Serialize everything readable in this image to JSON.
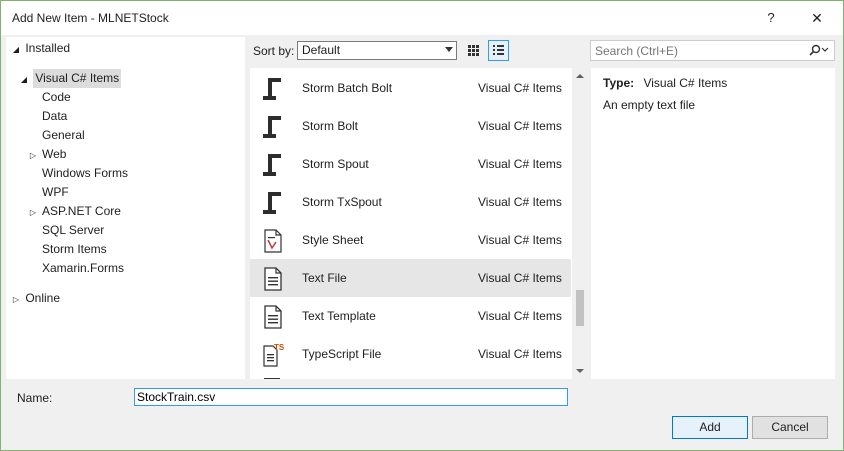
{
  "window": {
    "title": "Add New Item - MLNETStock",
    "help_label": "?",
    "close_label": "✕"
  },
  "tree": {
    "installed": "Installed",
    "root": "Visual C# Items",
    "children": [
      "Code",
      "Data",
      "General",
      "Web",
      "Windows Forms",
      "WPF",
      "ASP.NET Core",
      "SQL Server",
      "Storm Items",
      "Xamarin.Forms"
    ],
    "online": "Online"
  },
  "toolbar": {
    "sort_label": "Sort by:",
    "sort_value": "Default",
    "search_placeholder": "Search (Ctrl+E)"
  },
  "items": [
    {
      "name": "Storm Batch Bolt",
      "category": "Visual C# Items",
      "icon": "storm-icon"
    },
    {
      "name": "Storm Bolt",
      "category": "Visual C# Items",
      "icon": "storm-icon"
    },
    {
      "name": "Storm Spout",
      "category": "Visual C# Items",
      "icon": "storm-icon"
    },
    {
      "name": "Storm TxSpout",
      "category": "Visual C# Items",
      "icon": "storm-icon"
    },
    {
      "name": "Style Sheet",
      "category": "Visual C# Items",
      "icon": "stylesheet-icon"
    },
    {
      "name": "Text File",
      "category": "Visual C# Items",
      "icon": "text-file-icon"
    },
    {
      "name": "Text Template",
      "category": "Visual C# Items",
      "icon": "text-template-icon"
    },
    {
      "name": "TypeScript File",
      "category": "Visual C# Items",
      "icon": "typescript-file-icon"
    }
  ],
  "description": {
    "type_label": "Type:",
    "type_value": "Visual C# Items",
    "text": "An empty text file"
  },
  "footer": {
    "name_label": "Name:",
    "name_value": "StockTrain.csv",
    "add_label": "Add",
    "cancel_label": "Cancel"
  },
  "colors": {
    "selection": "#cce8ff",
    "selected_row": "#e6e6e6",
    "accent_border": "#0078d7",
    "typescript_badge": "#d04a02"
  }
}
